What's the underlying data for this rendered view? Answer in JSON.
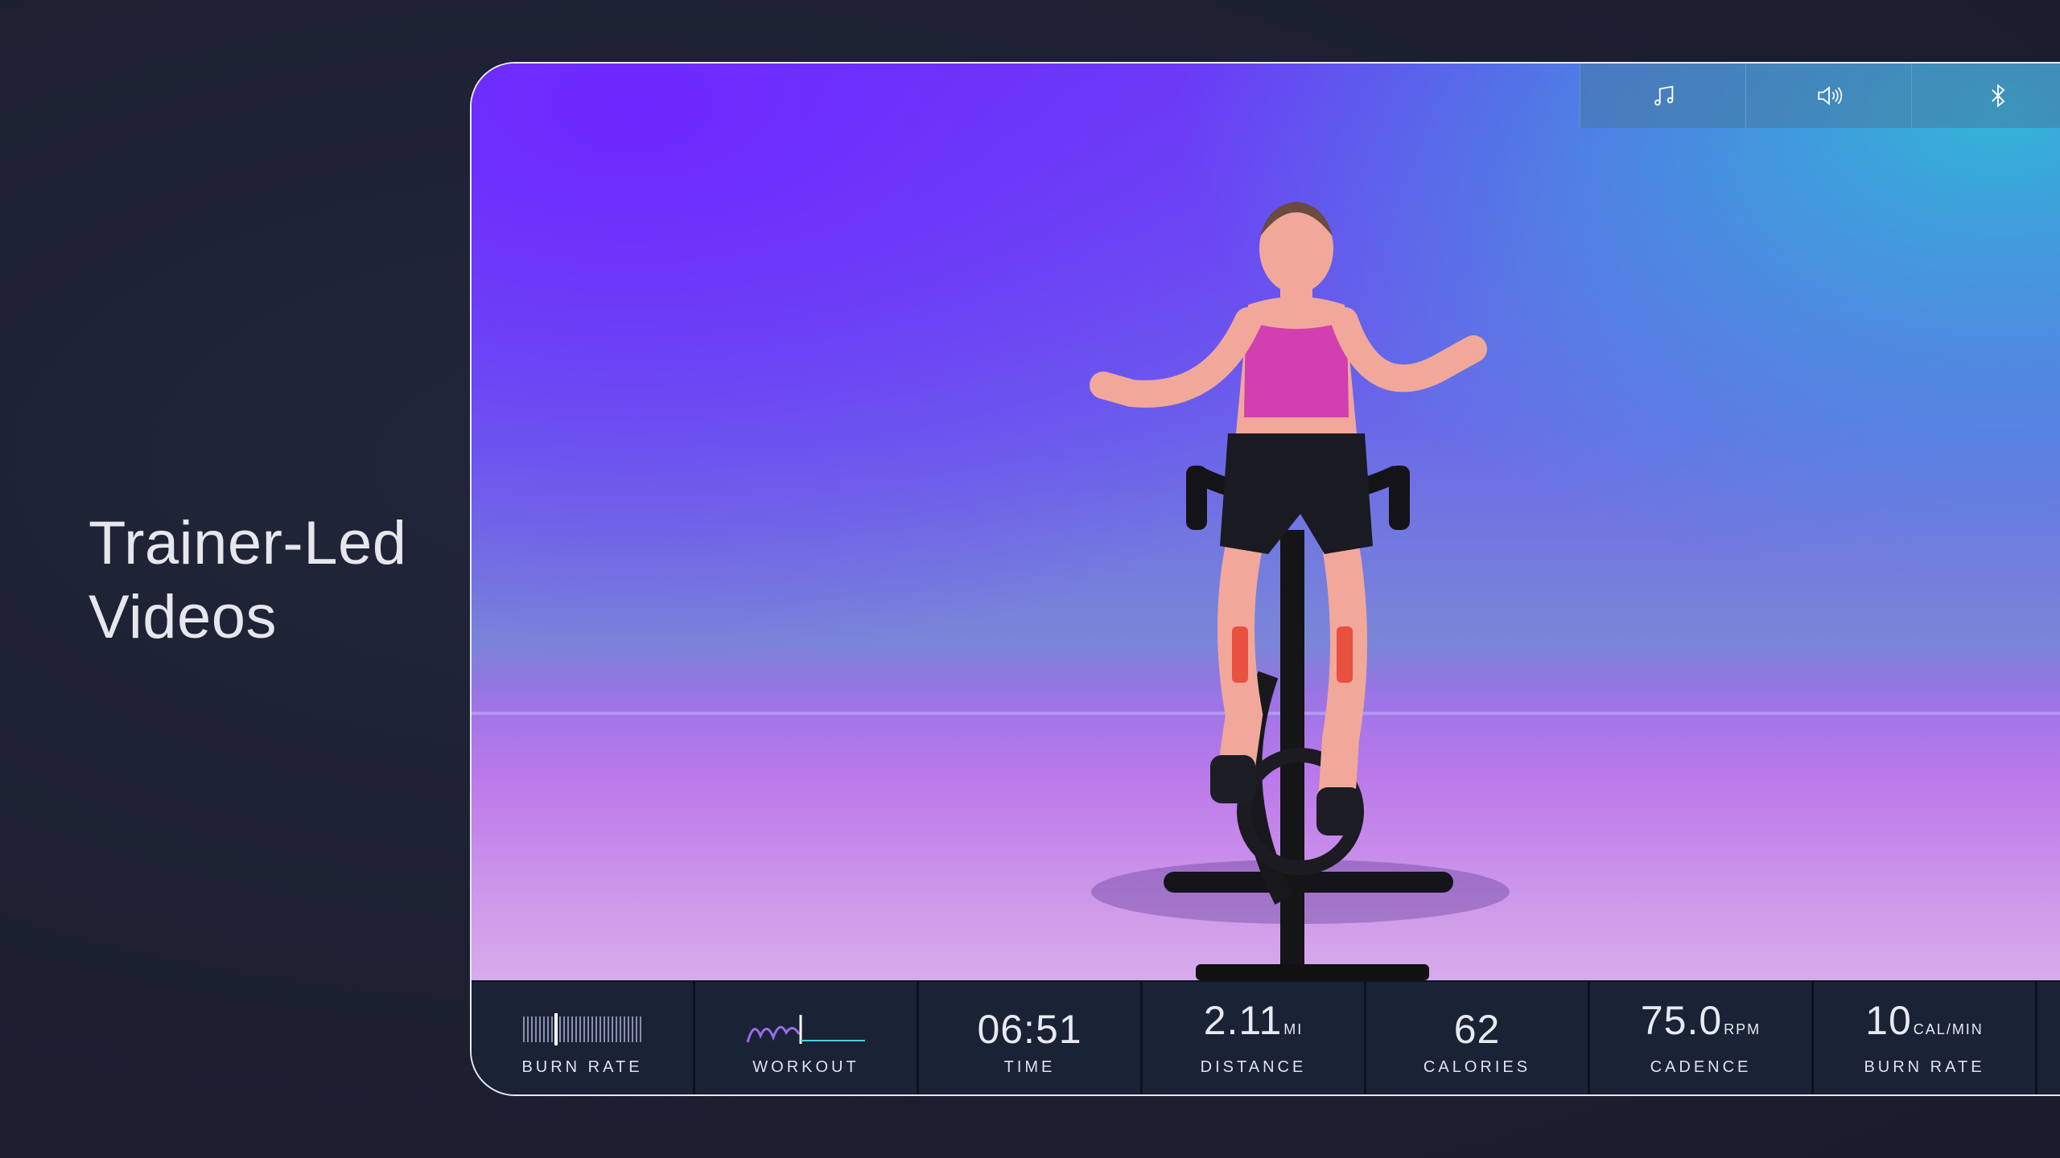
{
  "headline": {
    "line1": "Trainer-Led",
    "line2": "Videos"
  },
  "controls": [
    {
      "name": "music-button",
      "icon": "music-note-icon"
    },
    {
      "name": "volume-button",
      "icon": "speaker-icon"
    },
    {
      "name": "bluetooth-button",
      "icon": "bluetooth-icon"
    }
  ],
  "stats": {
    "burn_rate_graphic": {
      "label": "BURN RATE"
    },
    "workout": {
      "label": "WORKOUT"
    },
    "time": {
      "value": "06:51",
      "unit": "",
      "label": "TIME"
    },
    "distance": {
      "value": "2.11",
      "unit": "MI",
      "label": "DISTANCE"
    },
    "calories": {
      "value": "62",
      "unit": "",
      "label": "CALORIES"
    },
    "cadence": {
      "value": "75.0",
      "unit": "RPM",
      "label": "CADENCE"
    },
    "burn_rate": {
      "value": "10",
      "unit": "CAL/MIN",
      "label": "BURN RATE"
    }
  },
  "colors": {
    "background": "#1c2032",
    "stats_bar": "#1a2236",
    "accent_purple": "#9a6ee8",
    "accent_teal": "#4fd0d8"
  }
}
